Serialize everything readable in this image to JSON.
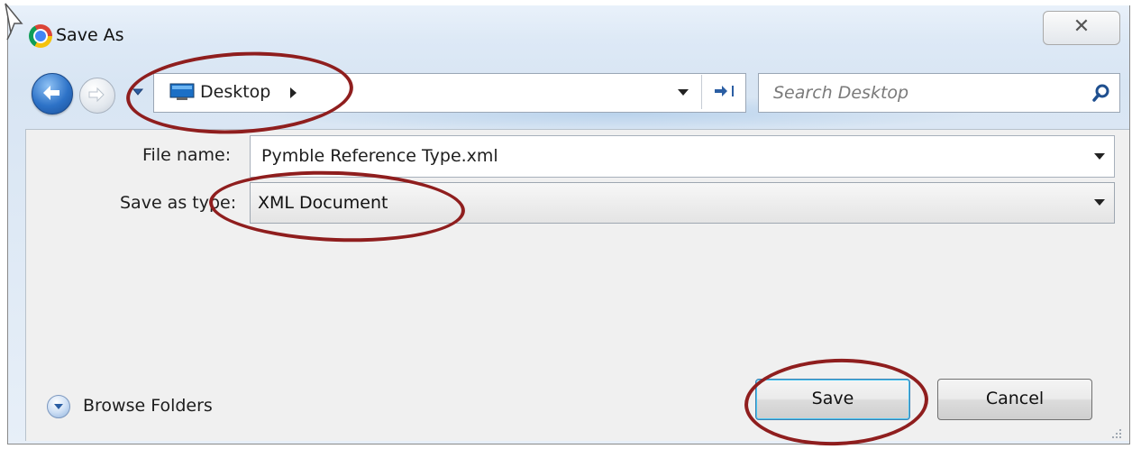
{
  "window": {
    "title": "Save As",
    "close_symbol": "✕"
  },
  "nav": {
    "back_icon": "back-arrow-icon",
    "forward_icon": "forward-arrow-icon",
    "address": "Desktop",
    "search_placeholder": "Search Desktop"
  },
  "form": {
    "file_name_label": "File name:",
    "file_name_value": "Pymble Reference Type.xml",
    "save_type_label": "Save as type:",
    "save_type_value": "XML Document"
  },
  "footer": {
    "browse_label": "Browse Folders",
    "save_label": "Save",
    "cancel_label": "Cancel"
  },
  "colors": {
    "annotation_ring": "#8f1e1e",
    "accent_blue": "#2d72c7"
  }
}
